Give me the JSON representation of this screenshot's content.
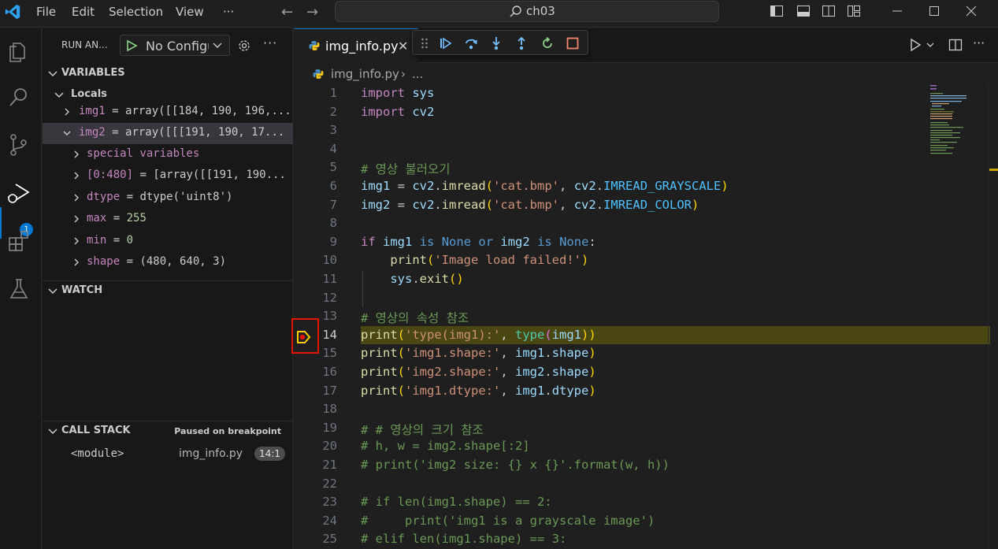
{
  "titlebar": {
    "menu": [
      "File",
      "Edit",
      "Selection",
      "View",
      "···"
    ],
    "search_text": "ch03"
  },
  "activity_bar": {
    "icons": [
      "explorer-icon",
      "search-icon",
      "source-control-icon",
      "run-debug-icon",
      "extensions-icon",
      "testing-icon"
    ],
    "debug_badge": "1"
  },
  "sidebar": {
    "title": "RUN AN...",
    "config_label": "No Configu",
    "more": "···",
    "variables": {
      "header": "VARIABLES",
      "locals_label": "Locals",
      "rows": [
        {
          "name": "img1",
          "eq": " = ",
          "value": "array([[184, 190, 196,..."
        },
        {
          "name": "img2",
          "eq": " = ",
          "value": "array([[[191, 190, 17..."
        },
        {
          "name": "special variables",
          "eq": "",
          "value": ""
        },
        {
          "name": "[0:480]",
          "eq": "  = ",
          "value": "[array([[191, 190..."
        },
        {
          "name": "dtype",
          "eq": " = ",
          "value": "dtype('uint8')"
        },
        {
          "name": "max",
          "eq": " = ",
          "value": "255"
        },
        {
          "name": "min",
          "eq": " = ",
          "value": "0"
        },
        {
          "name": "shape",
          "eq": " = ",
          "value": "(480, 640, 3)"
        }
      ]
    },
    "watch": {
      "header": "WATCH"
    },
    "call_stack": {
      "header": "CALL STACK",
      "status": "Paused on breakpoint",
      "frame_name": "<module>",
      "frame_file": "img_info.py",
      "frame_pos": "14:1"
    }
  },
  "editor": {
    "tab_name": "img_info.py",
    "tab_close": "✕",
    "breadcrumb_file": "img_info.py",
    "breadcrumb_sep": "›",
    "breadcrumb_more": "...",
    "current_line": 14,
    "lines": [
      {
        "n": "1"
      },
      {
        "n": "2"
      },
      {
        "n": "3"
      },
      {
        "n": "4"
      },
      {
        "n": "5"
      },
      {
        "n": "6"
      },
      {
        "n": "7"
      },
      {
        "n": "8"
      },
      {
        "n": "9"
      },
      {
        "n": "10"
      },
      {
        "n": "11"
      },
      {
        "n": "12"
      },
      {
        "n": "13"
      },
      {
        "n": "14"
      },
      {
        "n": "15"
      },
      {
        "n": "16"
      },
      {
        "n": "17"
      },
      {
        "n": "18"
      },
      {
        "n": "19"
      },
      {
        "n": "20"
      },
      {
        "n": "21"
      },
      {
        "n": "22"
      },
      {
        "n": "23"
      },
      {
        "n": "24"
      },
      {
        "n": "25"
      }
    ],
    "code": {
      "l1": [
        "import",
        " sys"
      ],
      "l2": [
        "import",
        " cv2"
      ],
      "l5": "# 영상 불러오기",
      "l6": [
        "img1",
        " = ",
        "cv2",
        ".",
        "imread",
        "(",
        "'cat.bmp'",
        ", ",
        "cv2",
        ".",
        "IMREAD_GRAYSCALE",
        ")"
      ],
      "l7": [
        "img2",
        " = ",
        "cv2",
        ".",
        "imread",
        "(",
        "'cat.bmp'",
        ", ",
        "cv2",
        ".",
        "IMREAD_COLOR",
        ")"
      ],
      "l9": [
        "if",
        " ",
        "img1",
        " ",
        "is",
        " ",
        "None",
        " ",
        "or",
        " ",
        "img2",
        " ",
        "is",
        " ",
        "None",
        ":"
      ],
      "l10": [
        "    ",
        "print",
        "(",
        "'Image load failed!'",
        ")"
      ],
      "l11": [
        "    ",
        "sys",
        ".",
        "exit",
        "()"
      ],
      "l13": "# 영상의 속성 참조",
      "l14": [
        "print",
        "(",
        "'type(img1):'",
        ", ",
        "type",
        "(",
        "img1",
        "))"
      ],
      "l15": [
        "print",
        "(",
        "'img1.shape:'",
        ", ",
        "img1",
        ".",
        "shape",
        ")"
      ],
      "l16": [
        "print",
        "(",
        "'img2.shape:'",
        ", ",
        "img2",
        ".",
        "shape",
        ")"
      ],
      "l17": [
        "print",
        "(",
        "'img1.dtype:'",
        ", ",
        "img1",
        ".",
        "dtype",
        ")"
      ],
      "l19": "# # 영상의 크기 참조",
      "l20": "# h, w = img2.shape[:2]",
      "l21": "# print('img2 size: {} x {}'.format(w, h))",
      "l23": "# if len(img1.shape) == 2:",
      "l24": "#     print('img1 is a grayscale image')",
      "l25": "# elif len(img1.shape) == 3:"
    }
  },
  "colors": {
    "accent": "#0078d4",
    "current_line": "#4b4712",
    "breakpoint_box": "#e51400",
    "debug_arrow": "#ffcc00",
    "play_green": "#89d185"
  }
}
